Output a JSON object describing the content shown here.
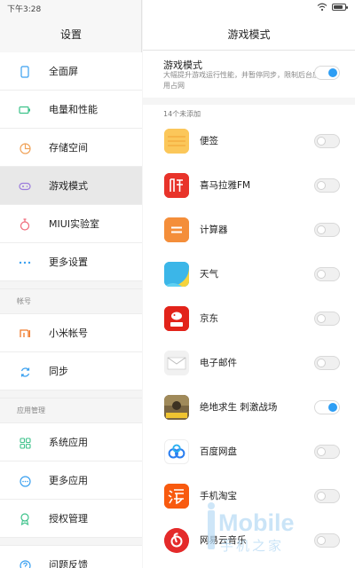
{
  "status_bar": {
    "time": "下午3:28",
    "battery_level_percent": 80
  },
  "left_pane": {
    "title": "设置",
    "items": [
      {
        "label": "全面屏",
        "icon": "phone-screen-icon",
        "active": false
      },
      {
        "label": "电量和性能",
        "icon": "battery-icon",
        "active": false
      },
      {
        "label": "存储空间",
        "icon": "storage-pie-icon",
        "active": false
      },
      {
        "label": "游戏模式",
        "icon": "gamepad-icon",
        "active": true
      },
      {
        "label": "MIUI实验室",
        "icon": "lab-flask-icon",
        "active": false
      },
      {
        "label": "更多设置",
        "icon": "more-dots-icon",
        "active": false
      }
    ],
    "account_section": {
      "label": "帐号",
      "items": [
        {
          "label": "小米帐号",
          "icon": "mi-logo-icon"
        },
        {
          "label": "同步",
          "icon": "sync-icon"
        }
      ]
    },
    "apps_section": {
      "label": "应用管理",
      "items": [
        {
          "label": "系统应用",
          "icon": "grid-apps-icon"
        },
        {
          "label": "更多应用",
          "icon": "more-apps-icon"
        },
        {
          "label": "授权管理",
          "icon": "authorization-badge-icon"
        }
      ]
    },
    "feedback": {
      "label": "问题反馈",
      "icon": "question-icon"
    }
  },
  "right_pane": {
    "title": "游戏模式",
    "game_mode": {
      "title": "游戏模式",
      "description": "大幅提升游戏运行性能，并暂停同步，限制后台应用占网",
      "enabled": true
    },
    "count_label": "14个未添加",
    "apps": [
      {
        "label": "便签",
        "icon": "notes-icon",
        "enabled": false
      },
      {
        "label": "喜马拉雅FM",
        "icon": "ximalaya-icon",
        "enabled": false
      },
      {
        "label": "计算器",
        "icon": "calculator-icon",
        "enabled": false
      },
      {
        "label": "天气",
        "icon": "weather-icon",
        "enabled": false
      },
      {
        "label": "京东",
        "icon": "jd-icon",
        "enabled": false
      },
      {
        "label": "电子邮件",
        "icon": "email-icon",
        "enabled": false
      },
      {
        "label": "绝地求生 刺激战场",
        "icon": "pubg-icon",
        "enabled": true
      },
      {
        "label": "百度网盘",
        "icon": "baidu-netdisk-icon",
        "enabled": false
      },
      {
        "label": "手机淘宝",
        "icon": "taobao-icon",
        "enabled": false
      },
      {
        "label": "网易云音乐",
        "icon": "netease-music-icon",
        "enabled": false
      }
    ]
  },
  "watermark": {
    "brand": "Mobile",
    "subtitle": "手机之家"
  },
  "colors": {
    "accent": "#2e9ef4",
    "toggle_off_bg": "#f0f0f0",
    "active_row": "#e8e8e8"
  }
}
